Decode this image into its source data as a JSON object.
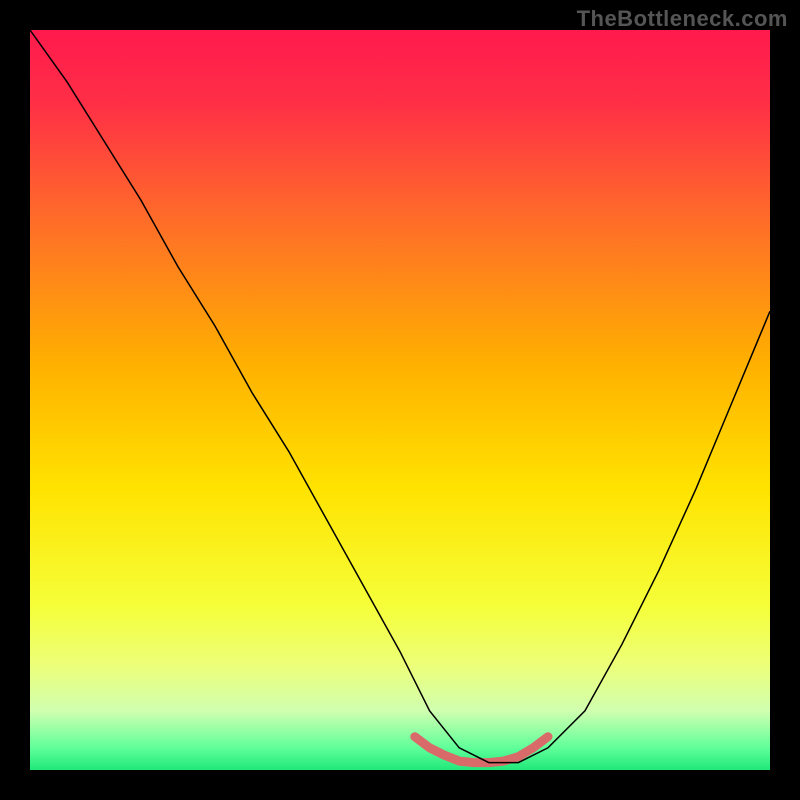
{
  "watermark": "TheBottleneck.com",
  "chart_data": {
    "type": "line",
    "title": "",
    "xlabel": "",
    "ylabel": "",
    "xlim": [
      0,
      100
    ],
    "ylim": [
      0,
      100
    ],
    "series": [
      {
        "name": "curve",
        "x": [
          0,
          5,
          10,
          15,
          20,
          25,
          30,
          35,
          40,
          45,
          50,
          54,
          58,
          62,
          66,
          70,
          75,
          80,
          85,
          90,
          95,
          100
        ],
        "y": [
          100,
          93,
          85,
          77,
          68,
          60,
          51,
          43,
          34,
          25,
          16,
          8,
          3,
          1,
          1,
          3,
          8,
          17,
          27,
          38,
          50,
          62
        ]
      },
      {
        "name": "bottom-highlight",
        "x": [
          52,
          54,
          56,
          58,
          60,
          62,
          64,
          66,
          68,
          70
        ],
        "y": [
          4.5,
          3,
          2,
          1.2,
          1,
          1,
          1.2,
          1.8,
          3,
          4.5
        ]
      }
    ],
    "gradient_stops": [
      {
        "offset": 0.0,
        "color": "#ff1a4d"
      },
      {
        "offset": 0.1,
        "color": "#ff2f46"
      },
      {
        "offset": 0.25,
        "color": "#ff6a2a"
      },
      {
        "offset": 0.45,
        "color": "#ffb000"
      },
      {
        "offset": 0.62,
        "color": "#ffe300"
      },
      {
        "offset": 0.78,
        "color": "#f5ff3a"
      },
      {
        "offset": 0.86,
        "color": "#ecff7a"
      },
      {
        "offset": 0.92,
        "color": "#d0ffb0"
      },
      {
        "offset": 0.97,
        "color": "#60ff9a"
      },
      {
        "offset": 1.0,
        "color": "#20e87a"
      }
    ],
    "curve_stroke": "#000000",
    "highlight_stroke": "#d96a6a",
    "highlight_width": 9
  }
}
